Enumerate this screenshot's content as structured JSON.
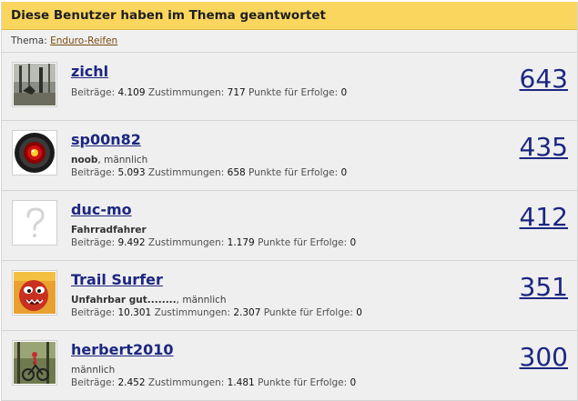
{
  "header": {
    "title": "Diese Benutzer haben im Thema geantwortet"
  },
  "subheader": {
    "label": "Thema:",
    "topic": "Enduro-Reifen"
  },
  "stat_labels": {
    "posts": "Beiträge:",
    "likes": "Zustimmungen:",
    "trophy": "Punkte für Erfolge:"
  },
  "users": [
    {
      "name": "zichl",
      "title": "",
      "gender": "",
      "posts": "4.109",
      "likes": "717",
      "trophy": "0",
      "count": "643",
      "avatar_icon": "forest-photo-icon"
    },
    {
      "name": "sp00n82",
      "title": "noob",
      "gender": ", männlich",
      "posts": "5.093",
      "likes": "658",
      "trophy": "0",
      "count": "435",
      "avatar_icon": "hal9000-eye-icon"
    },
    {
      "name": "duc-mo",
      "title": "Fahrradfahrer",
      "gender": "",
      "posts": "9.492",
      "likes": "1.179",
      "trophy": "0",
      "count": "412",
      "avatar_icon": "question-mark-icon"
    },
    {
      "name": "Trail Surfer",
      "title": "Unfahrbar gut........",
      "gender": ", männlich",
      "posts": "10.301",
      "likes": "2.307",
      "trophy": "0",
      "count": "351",
      "avatar_icon": "cartoon-face-icon"
    },
    {
      "name": "herbert2010",
      "title": "",
      "gender": "männlich",
      "posts": "2.452",
      "likes": "1.481",
      "trophy": "0",
      "count": "300",
      "avatar_icon": "mountainbike-photo-icon"
    }
  ],
  "colors": {
    "header_bg": "#fad65e",
    "link": "#1c2780",
    "panel_bg": "#f0f0f0"
  }
}
